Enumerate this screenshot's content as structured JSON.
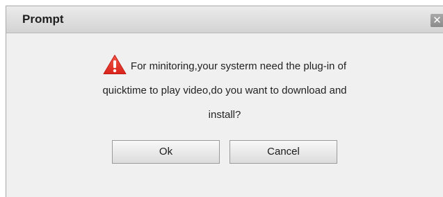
{
  "dialog": {
    "title": "Prompt",
    "close_symbol": "✕",
    "icon": "warning-triangle-icon",
    "message_lines": [
      "For minitoring,your systerm need the plug-in of",
      "quicktime to play video,do you want to download and",
      "install?"
    ],
    "ok_label": "Ok",
    "cancel_label": "Cancel"
  },
  "colors": {
    "warning_red": "#e52a1e",
    "dialog_bg": "#f0f0f0"
  }
}
